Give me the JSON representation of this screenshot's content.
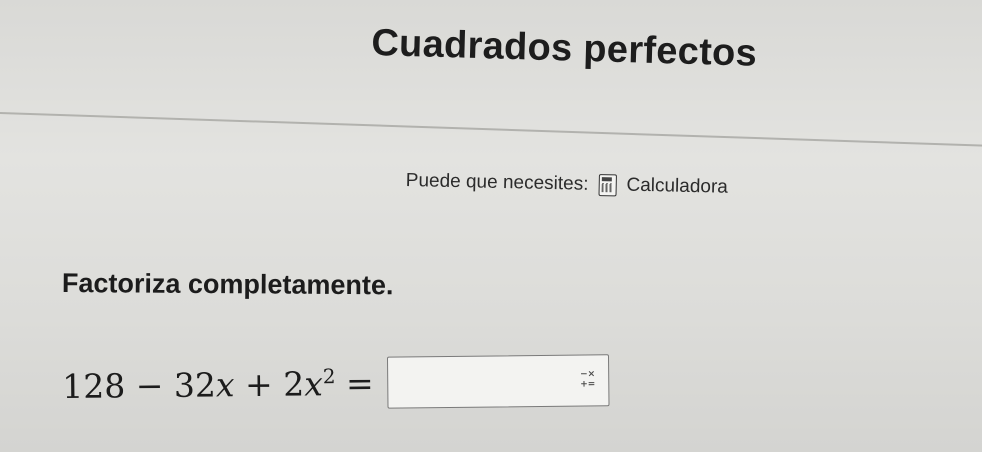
{
  "header": {
    "title": "Cuadrados perfectos"
  },
  "tools": {
    "prefix": "Puede que necesites:",
    "calculator_label": "Calculadora"
  },
  "problem": {
    "instruction": "Factoriza completamente.",
    "equation": {
      "term1": "128",
      "op1": "−",
      "coef2": "32",
      "var2": "x",
      "op2": "+",
      "coef3": "2",
      "var3": "x",
      "exp3": "2",
      "equals": "="
    },
    "answer": {
      "value": "",
      "keypad_icon": "math-keypad-icon",
      "keypad_glyph_top": "−×",
      "keypad_glyph_bottom": "+="
    }
  }
}
